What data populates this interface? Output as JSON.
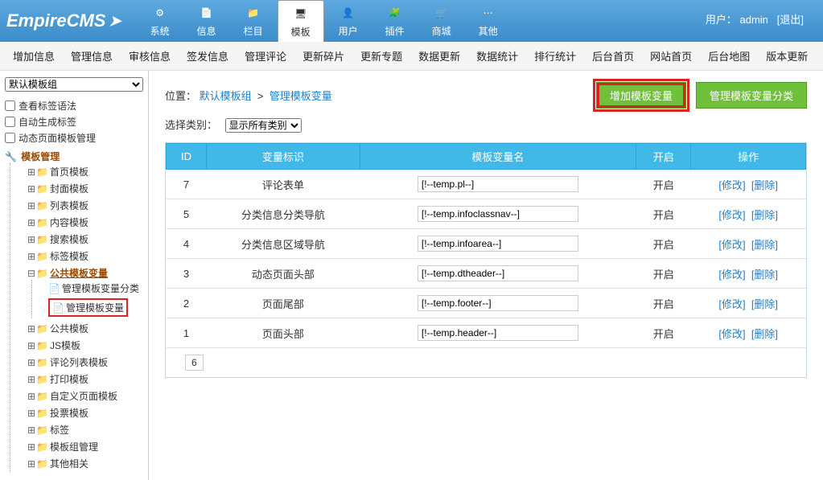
{
  "logo": "EmpireCMS",
  "user": {
    "label": "用户：",
    "name": "admin",
    "logout": "[退出]"
  },
  "nav": [
    {
      "label": "系统"
    },
    {
      "label": "信息"
    },
    {
      "label": "栏目"
    },
    {
      "label": "模板",
      "active": true
    },
    {
      "label": "用户"
    },
    {
      "label": "插件"
    },
    {
      "label": "商城"
    },
    {
      "label": "其他"
    }
  ],
  "submenu": [
    "增加信息",
    "管理信息",
    "审核信息",
    "签发信息",
    "管理评论",
    "更新碎片",
    "更新专题",
    "数据更新",
    "数据统计",
    "排行统计",
    "后台首页",
    "网站首页",
    "后台地图",
    "版本更新"
  ],
  "sidebar": {
    "group_select": "默认模板组",
    "checks": [
      {
        "label": "查看标签语法"
      },
      {
        "label": "自动生成标签"
      },
      {
        "label": "动态页面模板管理"
      }
    ],
    "root_label": "模板管理",
    "folders": [
      "首页模板",
      "封面模板",
      "列表模板",
      "内容模板",
      "搜索模板",
      "标签模板"
    ],
    "open_folder": {
      "label": "公共模板变量",
      "children": [
        {
          "label": "管理模板变量分类",
          "highlight": false
        },
        {
          "label": "管理模板变量",
          "highlight": true
        }
      ]
    },
    "folders2": [
      "公共模板",
      "JS模板",
      "评论列表模板",
      "打印模板",
      "自定义页面模板",
      "投票模板",
      "标签",
      "模板组管理",
      "其他相关"
    ]
  },
  "main": {
    "breadcrumb": {
      "prefix": "位置：",
      "group": "默认模板组",
      "sep": ">",
      "page": "管理模板变量"
    },
    "btn_add": "增加模板变量",
    "btn_cat": "管理模板变量分类",
    "filter_label": "选择类别：",
    "filter_value": "显示所有类别",
    "columns": {
      "id": "ID",
      "mark": "变量标识",
      "name": "模板变量名",
      "open": "开启",
      "op": "操作"
    },
    "open_text": "开启",
    "op_edit": "[修改]",
    "op_del": "[删除]",
    "rows": [
      {
        "id": "7",
        "mark": "评论表单",
        "name": "[!--temp.pl--]"
      },
      {
        "id": "5",
        "mark": "分类信息分类导航",
        "name": "[!--temp.infoclassnav--]"
      },
      {
        "id": "4",
        "mark": "分类信息区域导航",
        "name": "[!--temp.infoarea--]"
      },
      {
        "id": "3",
        "mark": "动态页面头部",
        "name": "[!--temp.dtheader--]"
      },
      {
        "id": "2",
        "mark": "页面尾部",
        "name": "[!--temp.footer--]"
      },
      {
        "id": "1",
        "mark": "页面头部",
        "name": "[!--temp.header--]"
      }
    ],
    "page_count": "6"
  }
}
